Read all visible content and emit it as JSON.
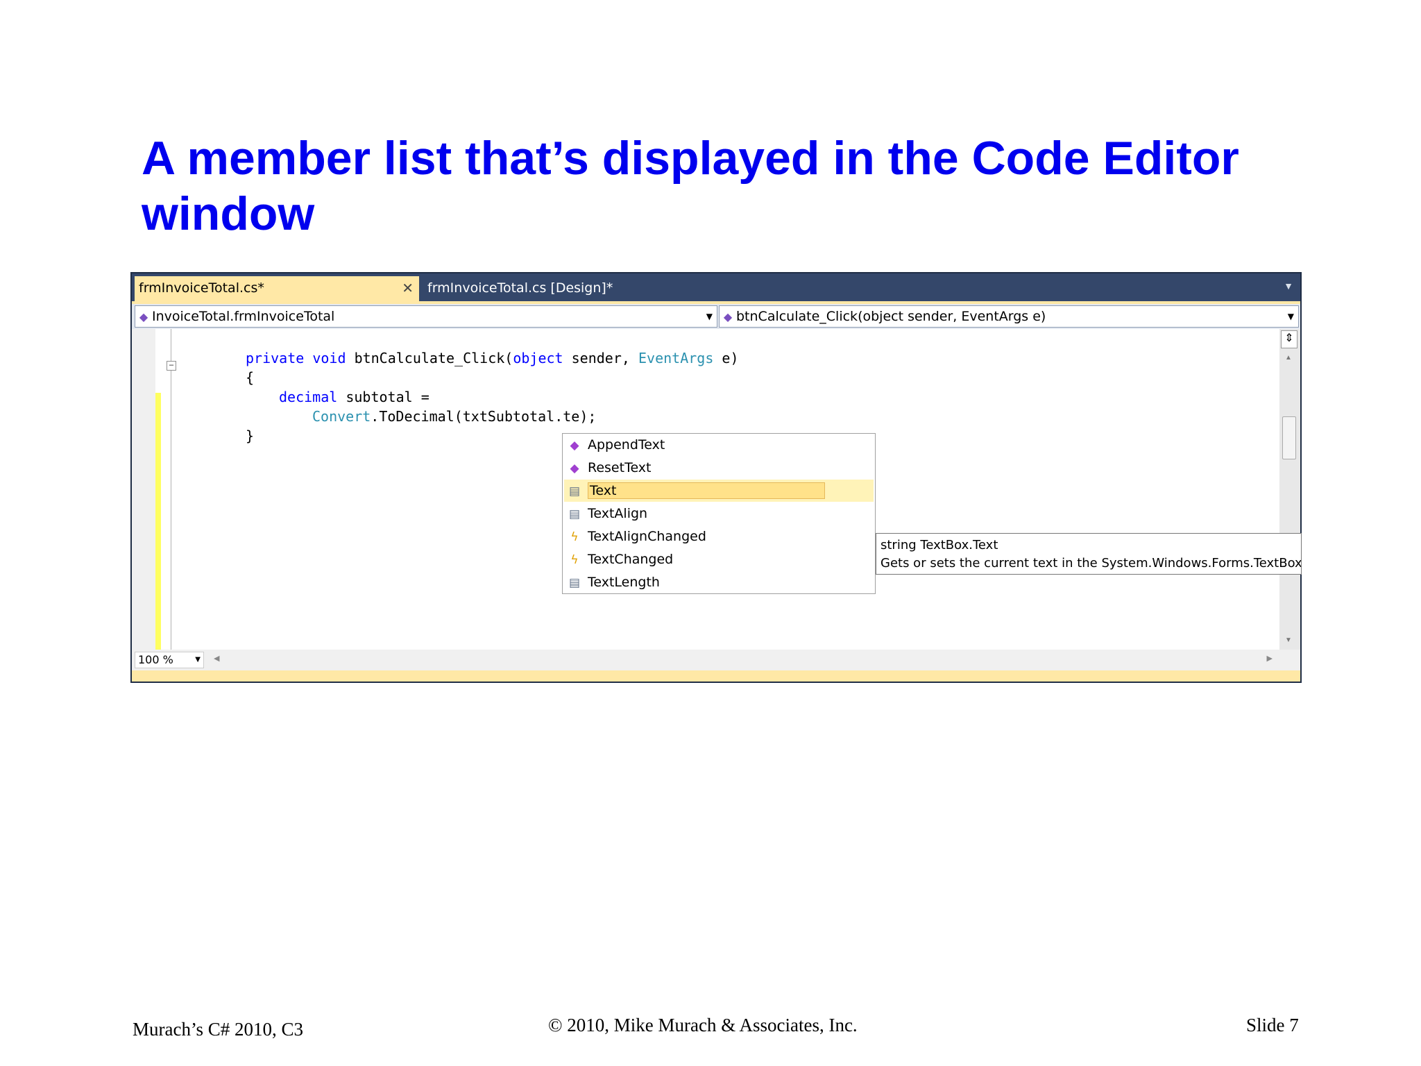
{
  "slide": {
    "title": "A member list that’s displayed in the Code Editor window"
  },
  "ide": {
    "tabs": [
      {
        "label": "frmInvoiceTotal.cs*",
        "active": true
      },
      {
        "label": "frmInvoiceTotal.cs [Design]*",
        "active": false
      }
    ],
    "tab_close_glyph": "✕",
    "nav": {
      "class_combo": "InvoiceTotal.frmInvoiceTotal",
      "member_combo": "btnCalculate_Click(object sender, EventArgs e)"
    },
    "code": {
      "line1": {
        "kw1": "private",
        "kw2": "void",
        "name": "btnCalculate_Click(",
        "kw3": "object",
        "mid": "sender,",
        "type": "EventArgs",
        "end": "e)"
      },
      "line2": "{",
      "line3": {
        "kw": "decimal",
        "rest": "subtotal ="
      },
      "line4": {
        "type": "Convert",
        "rest": ".ToDecimal(txtSubtotal.te);"
      },
      "line5": "}"
    },
    "member_list": [
      {
        "label": "AppendText",
        "icon": "method-icon",
        "selected": false
      },
      {
        "label": "ResetText",
        "icon": "method-icon",
        "selected": false
      },
      {
        "label": "Text",
        "icon": "property-icon",
        "selected": true
      },
      {
        "label": "TextAlign",
        "icon": "property-icon",
        "selected": false
      },
      {
        "label": "TextAlignChanged",
        "icon": "event-icon",
        "selected": false
      },
      {
        "label": "TextChanged",
        "icon": "event-icon",
        "selected": false
      },
      {
        "label": "TextLength",
        "icon": "property-icon",
        "selected": false
      }
    ],
    "tooltip": {
      "line1": "string TextBox.Text",
      "line2": "Gets or sets the current text in the System.Windows.Forms.TextBox."
    },
    "zoom": "100 %",
    "colors": {
      "keyword": "#0000ff",
      "type": "#2b91af",
      "selection": "#ffe28a",
      "ide_frame": "#2b3c58",
      "title": "#0000ee"
    }
  },
  "footer": {
    "left": "Murach’s C# 2010, C3",
    "center": "© 2010, Mike Murach & Associates, Inc.",
    "right": "Slide 7"
  }
}
